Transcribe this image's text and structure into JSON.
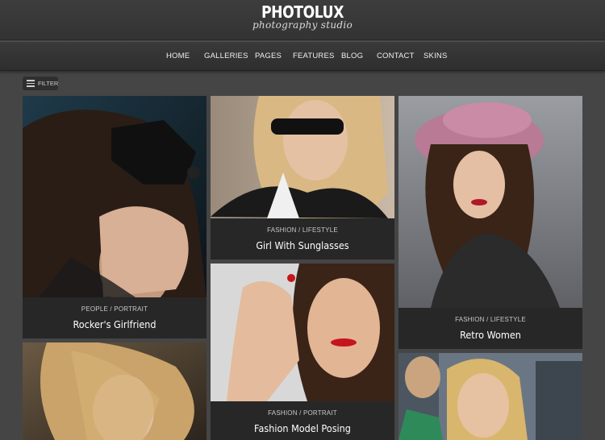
{
  "site": {
    "logo": "PHOTOLUX",
    "tagline": "photography studio"
  },
  "nav": {
    "items": [
      "HOME",
      "GALLERIES",
      "PAGES",
      "FEATURES",
      "BLOG",
      "CONTACT",
      "SKINS"
    ]
  },
  "filter": {
    "label": "FILTER",
    "icon": "menu-lines-icon"
  },
  "gallery": {
    "items": [
      {
        "category": "PEOPLE / PORTRAIT",
        "title": "Rocker's Girlfriend"
      },
      {
        "category": "FASHION / LIFESTYLE",
        "title": "Girl With Sunglasses"
      },
      {
        "category": "FASHION / LIFESTYLE",
        "title": "Retro Women"
      },
      {
        "category": "FASHION / PORTRAIT",
        "title": "Fashion Model Posing"
      }
    ]
  },
  "colors": {
    "page_bg": "#454545",
    "header_bg": "#383838",
    "caption_bg": "#272727",
    "text": "#ffffff"
  }
}
